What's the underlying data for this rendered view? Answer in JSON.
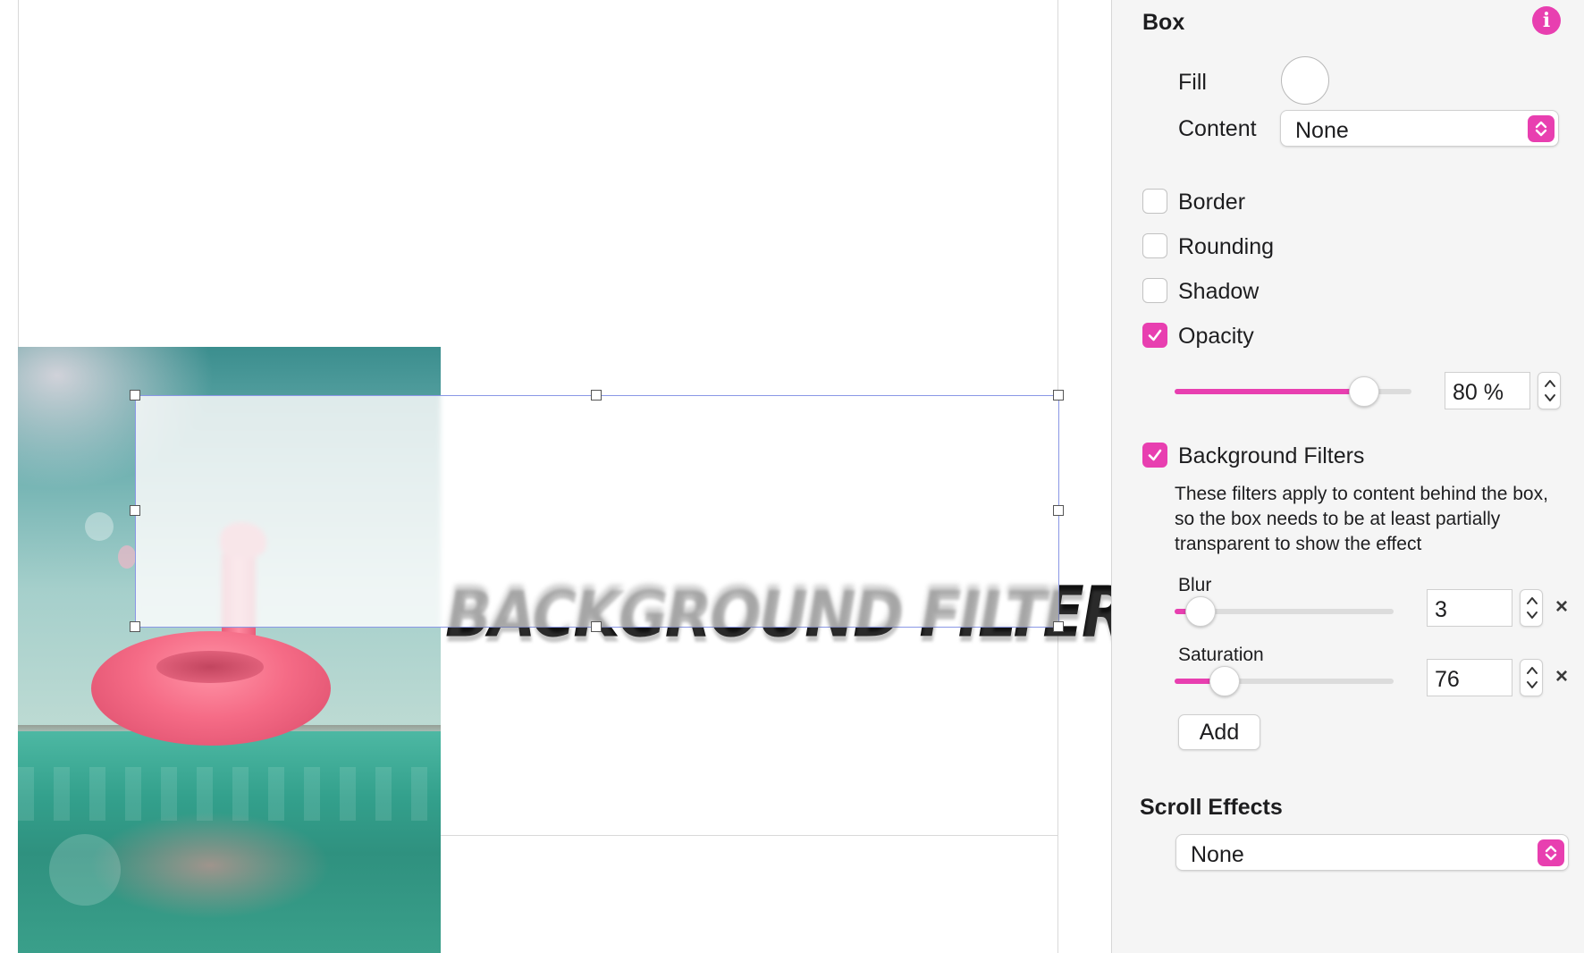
{
  "canvas": {
    "title_text": "BACKGROUND FILTER"
  },
  "inspector": {
    "box_heading": "Box",
    "fill_label": "Fill",
    "content_label": "Content",
    "content_value": "None",
    "border_label": "Border",
    "border_checked": false,
    "rounding_label": "Rounding",
    "rounding_checked": false,
    "shadow_label": "Shadow",
    "shadow_checked": false,
    "opacity_label": "Opacity",
    "opacity_checked": true,
    "opacity_value": "80 %",
    "opacity_percent": 80,
    "bg_filters_label": "Background Filters",
    "bg_filters_checked": true,
    "bg_filters_desc": "These filters apply to content behind the box, so the box needs to be at least partially transparent to show the effect",
    "filters": [
      {
        "label": "Blur",
        "value": "3",
        "level": 0.12
      },
      {
        "label": "Saturation",
        "value": "76",
        "level": 0.23
      }
    ],
    "add_label": "Add",
    "scroll_heading": "Scroll Effects",
    "scroll_value": "None"
  },
  "colors": {
    "accent": "#e83fb0",
    "selection": "#8a97e6"
  }
}
